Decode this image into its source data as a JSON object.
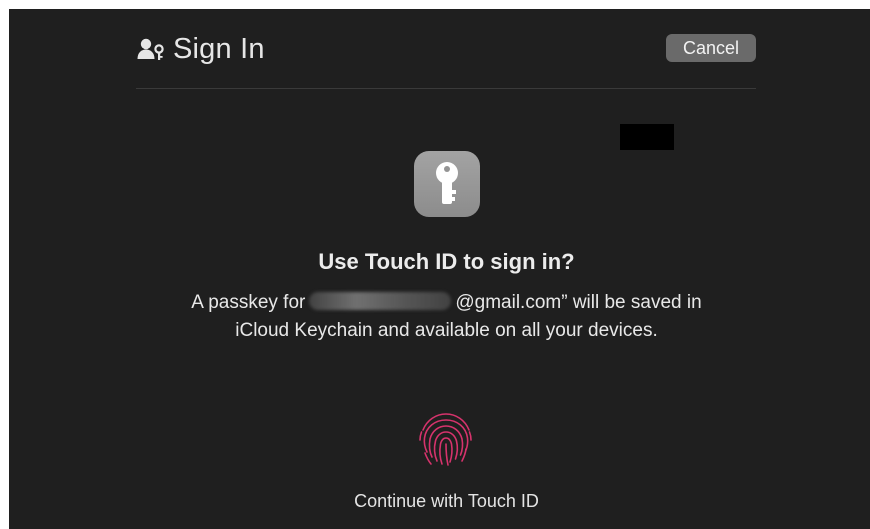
{
  "dialog": {
    "title": "Sign In",
    "cancel_label": "Cancel",
    "heading": "Use Touch ID to sign in?",
    "desc_prefix": "A passkey for",
    "desc_suffix": "@gmail.com” will be saved in iCloud Keychain and available on all your devices.",
    "continue_label": "Continue with Touch ID"
  },
  "icons": {
    "title": "person-key-icon",
    "app": "keychain-key-icon",
    "touch": "fingerprint-icon"
  },
  "colors": {
    "background": "#1f1f1f",
    "button": "#6a6a6a",
    "fingerprint": "#d6336c",
    "key_tile": "#9a9a9a"
  }
}
